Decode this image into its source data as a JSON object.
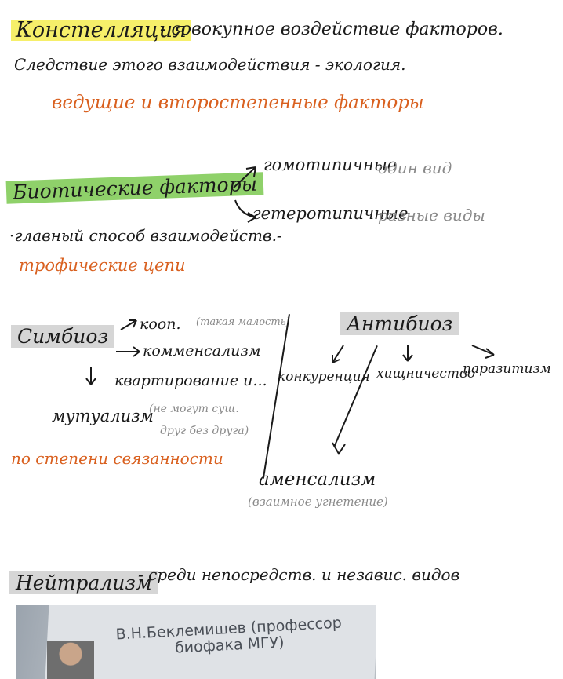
{
  "section1": {
    "term": "Констелляция",
    "definition": "- совокупное воздействие факторов.",
    "line2": "Следствие этого взаимодействия - экология.",
    "note": "ведущие и второстепенные факторы"
  },
  "section2": {
    "term": "Биотические факторы",
    "branch_homo": "гомотипичные",
    "branch_homo_note": "один вид",
    "branch_hetero": "гетеротипичные",
    "branch_hetero_note": "разные виды",
    "line": "·главный способ взаимодейств.-",
    "note": "трофические цепи"
  },
  "section3": {
    "symbiosis": "Симбиоз",
    "s1": "кооп.",
    "s1_note": "(такая малость)",
    "s2": "комменсализм",
    "s3": "квартирование и...",
    "s4": "мутуализм",
    "s4_note_1": "(не могут сущ.",
    "s4_note_2": "друг без друга)",
    "note": "по степени связанности",
    "antibiosis": "Антибиоз",
    "a1": "конкуренция",
    "a2": "хищничество",
    "a3": "паразитизм",
    "a4": "аменсализм",
    "a4_note": "(взаимное угнетение)"
  },
  "section4": {
    "term": "Нейтрализм",
    "definition": "- среди непосредств. и независ. видов"
  },
  "photo": {
    "caption_line1": "В.Н.Беклемишев (профессор",
    "caption_line2": "биофака МГУ)"
  }
}
